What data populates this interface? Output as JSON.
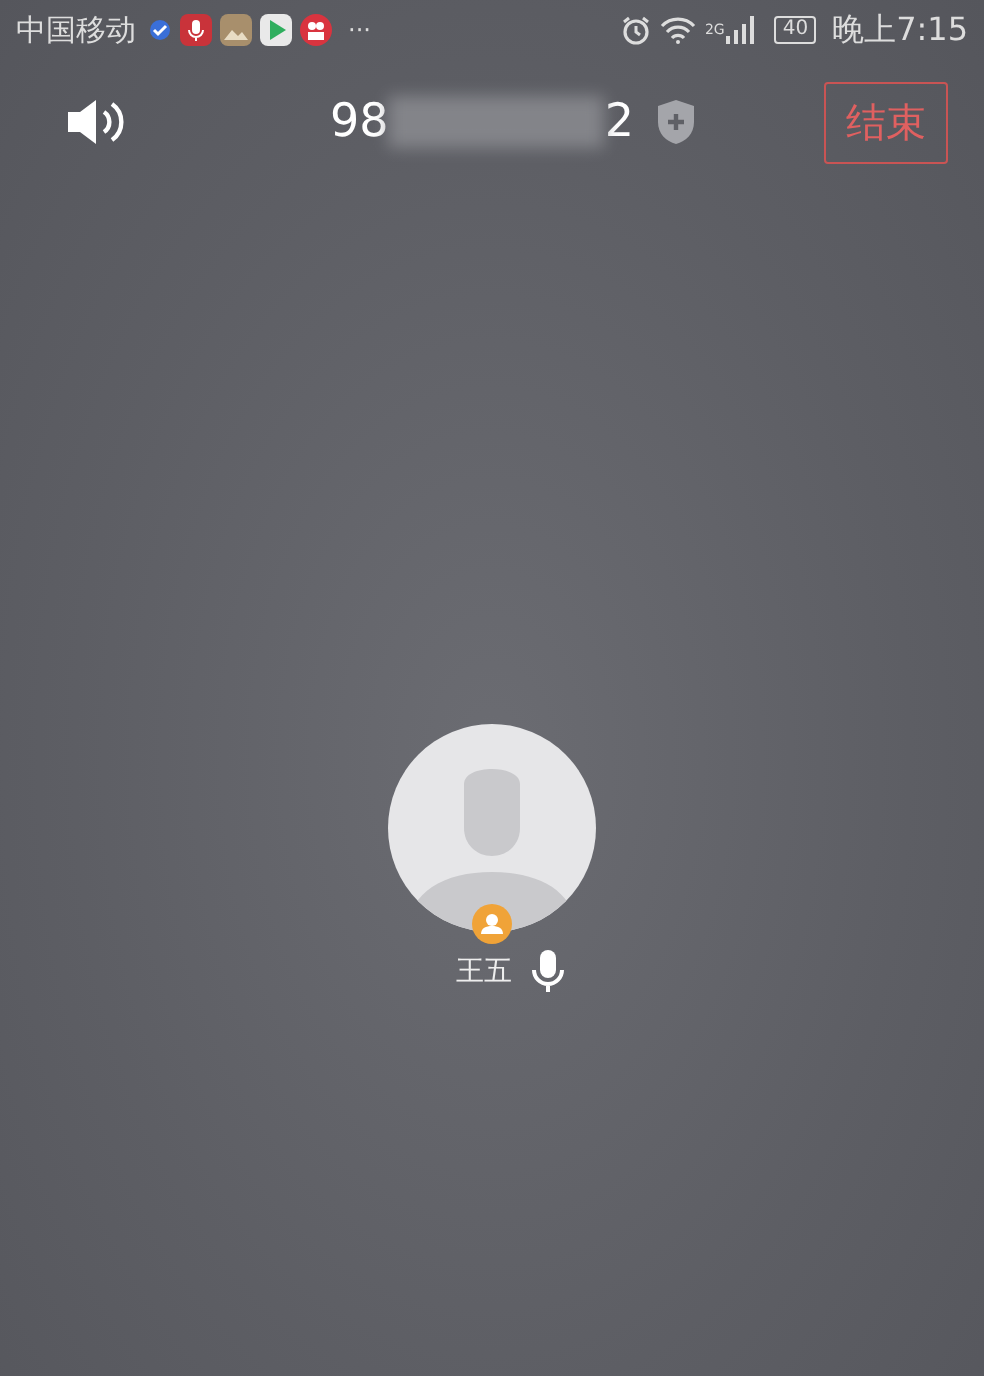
{
  "status_bar": {
    "carrier": "中国移动",
    "more": "···",
    "battery": "40",
    "time": "晚上7:15",
    "network": "2G"
  },
  "call": {
    "number_start": "98",
    "number_end": "2",
    "end_button": "结束"
  },
  "participants": [
    {
      "name": "王五",
      "mic_on": true
    }
  ]
}
